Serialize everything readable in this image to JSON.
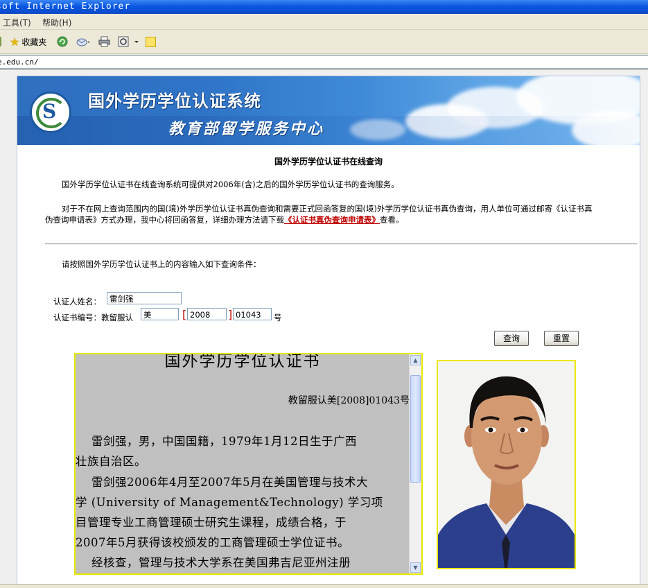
{
  "window": {
    "title": "soft Internet Explorer"
  },
  "menu": {
    "tools": "工具(T)",
    "help": "帮助(H)"
  },
  "toolbar": {
    "favorites": "收藏夹"
  },
  "address": {
    "url": "e.edu.cn/"
  },
  "banner": {
    "title": "国外学历学位认证系统",
    "subtitle": "教育部留学服务中心"
  },
  "content": {
    "heading": "国外学历学位认证书在线查询",
    "intro": "国外学历学位认证书在线查询系统可提供对2006年(含)之后的国外学历学位认证书的查询服务。",
    "notice_line1": "对于不在网上查询范围内的国(境)外学历学位认证书真伪查询和需要正式回函答复的国(境)外学历学位认证书真伪查询，用人单位可通过邮寄《认证书真",
    "notice_line2_pre": "伪查询申请表》方式办理，我中心将回函答复，详细办理方法请下载",
    "notice_link": "《认证书真伪查询申请表》",
    "notice_line2_post": "查看。",
    "query_prompt": "请按照国外学历学位认证书上的内容输入如下查询条件："
  },
  "form": {
    "name_label": "认证人姓名：",
    "name_value": "雷剑强",
    "cert_label": "认证书编号：教留服认",
    "country_value": "美",
    "year_value": "2008",
    "number_value": "01043",
    "bracket_open": "[",
    "bracket_close": "]",
    "suffix": "号",
    "query_button": "查询",
    "reset_button": "重置"
  },
  "certificate": {
    "title": "国外学历学位认证书",
    "number": "教留服认美[2008]01043号",
    "lines": [
      "    雷剑强，男，中国国籍，1979年1月12日生于广西",
      "壮族自治区。",
      "    雷剑强2006年4月至2007年5月在美国管理与技术大",
      "学 (University of Management&Technology) 学习项",
      "目管理专业工商管理硕士研究生课程，成绩合格，于",
      "2007年5月获得该校颁发的工商管理硕士学位证书。",
      "    经核查，管理与技术大学系在美国弗吉尼亚州注册"
    ]
  },
  "colors": {
    "title_bar": "#0a58e0",
    "link_red": "#c00000",
    "frame_yellow": "#e8e800",
    "cert_bg": "#c0c0c0"
  },
  "icons": [
    "star-icon",
    "refresh-icon",
    "mail-icon",
    "print-icon",
    "edit-icon",
    "note-icon",
    "scroll-up-icon",
    "scroll-down-icon"
  ]
}
